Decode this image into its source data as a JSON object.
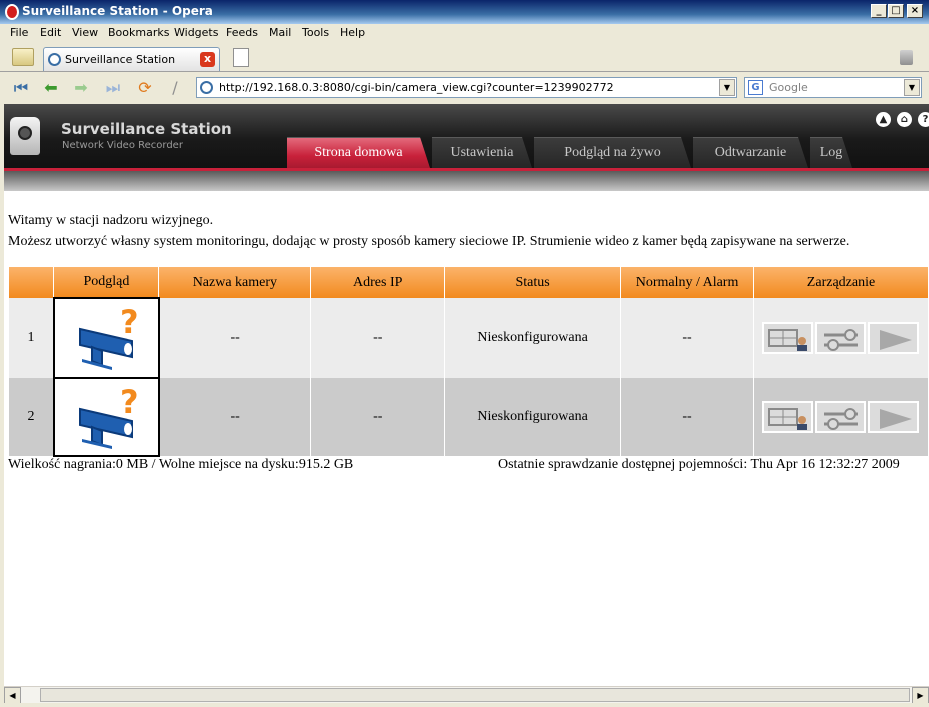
{
  "window": {
    "title": "Surveillance Station - Opera",
    "controls": [
      "_",
      "□",
      "×"
    ]
  },
  "menu": [
    "File",
    "Edit",
    "View",
    "Bookmarks",
    "Widgets",
    "Feeds",
    "Mail",
    "Tools",
    "Help"
  ],
  "browser_tab": {
    "label": "Surveillance Station",
    "close": "x"
  },
  "address": {
    "url": "http://192.168.0.3:8080/cgi-bin/camera_view.cgi?counter=1239902772",
    "search_placeholder": "Google",
    "search_logo": "G"
  },
  "header": {
    "brand": "Surveillance Station",
    "subtitle": "Network Video Recorder",
    "tabs": [
      "Strona domowa",
      "Ustawienia",
      "Podgląd na żywo",
      "Odtwarzanie",
      "Log"
    ],
    "active_tab": 0,
    "icons": [
      "logout-icon",
      "home-icon",
      "help-icon"
    ],
    "icon_glyphs": [
      "▲",
      "⌂",
      "?"
    ]
  },
  "welcome": {
    "line1": "Witamy w stacji nadzoru wizyjnego.",
    "line2": "Możesz utworzyć własny system monitoringu, dodając w prosty sposób kamery sieciowe IP. Strumienie wideo z kamer będą zapisywane na serwerze."
  },
  "table": {
    "headers": [
      "",
      "Podgląd",
      "Nazwa kamery",
      "Adres IP",
      "Status",
      "Normalny / Alarm",
      "Zarządzanie"
    ],
    "rows": [
      {
        "no": "1",
        "name": "--",
        "ip": "--",
        "status": "Nieskonfigurowana",
        "mode": "--"
      },
      {
        "no": "2",
        "name": "--",
        "ip": "--",
        "status": "Nieskonfigurowana",
        "mode": "--"
      }
    ]
  },
  "footer": {
    "left": "Wielkość nagrania:0 MB / Wolne miejsce na dysku:915.2 GB",
    "right": "Ostatnie sprawdzanie dostępnej pojemności: Thu Apr 16 12:32:27 2009"
  },
  "colors": {
    "accent": "#C8213A",
    "table_header": "#F28A1E",
    "camera_blue": "#1F5FB0",
    "question_orange": "#F28A1E"
  }
}
